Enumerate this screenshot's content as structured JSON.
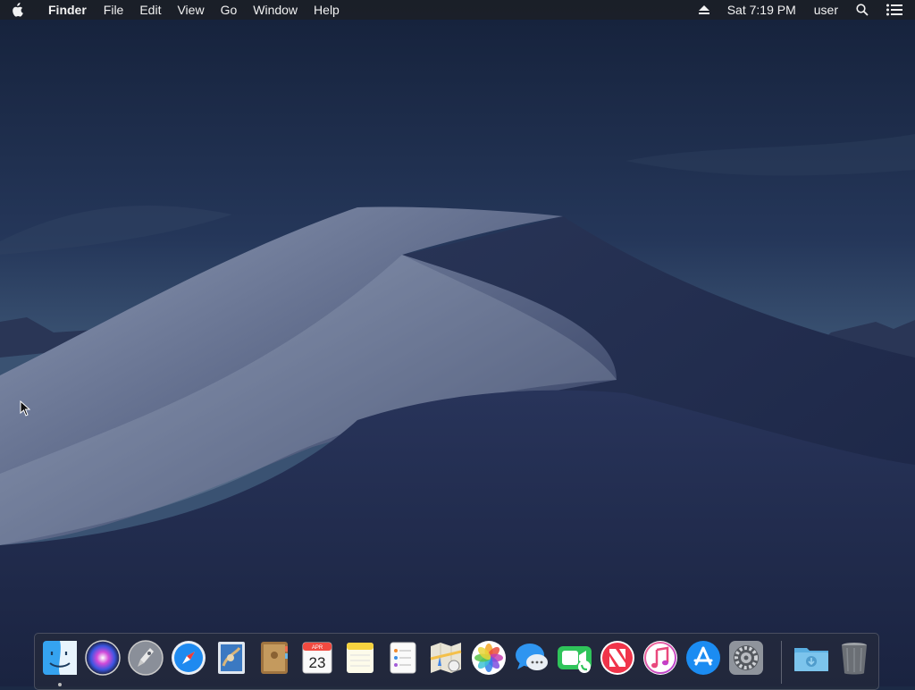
{
  "menubar": {
    "app_name": "Finder",
    "menus": [
      "File",
      "Edit",
      "View",
      "Go",
      "Window",
      "Help"
    ],
    "clock": "Sat 7:19 PM",
    "user": "user",
    "icons": [
      "apple-icon",
      "eject-icon",
      "spotlight-icon",
      "notification-center-icon"
    ]
  },
  "dock": {
    "apps": [
      {
        "name": "Finder",
        "icon": "finder-icon",
        "running": true
      },
      {
        "name": "Siri",
        "icon": "siri-icon"
      },
      {
        "name": "Launchpad",
        "icon": "launchpad-icon"
      },
      {
        "name": "Safari",
        "icon": "safari-icon"
      },
      {
        "name": "Mail",
        "icon": "mail-icon"
      },
      {
        "name": "Contacts",
        "icon": "contacts-icon"
      },
      {
        "name": "Calendar",
        "icon": "calendar-icon",
        "month": "APR",
        "day": "23"
      },
      {
        "name": "Notes",
        "icon": "notes-icon"
      },
      {
        "name": "Reminders",
        "icon": "reminders-icon"
      },
      {
        "name": "Maps",
        "icon": "maps-icon"
      },
      {
        "name": "Photos",
        "icon": "photos-icon"
      },
      {
        "name": "Messages",
        "icon": "messages-icon"
      },
      {
        "name": "FaceTime",
        "icon": "facetime-icon"
      },
      {
        "name": "News",
        "icon": "news-icon"
      },
      {
        "name": "iTunes",
        "icon": "itunes-icon"
      },
      {
        "name": "App Store",
        "icon": "app-store-icon"
      },
      {
        "name": "System Preferences",
        "icon": "system-preferences-icon"
      }
    ],
    "others": [
      {
        "name": "Downloads",
        "icon": "downloads-folder-icon"
      },
      {
        "name": "Trash",
        "icon": "trash-icon"
      }
    ]
  },
  "colors": {
    "sky_top": "#14203a",
    "sky_bottom": "#3a5070",
    "dune_light": "#9aa6bf",
    "dune_shadow": "#1e2a4c"
  }
}
